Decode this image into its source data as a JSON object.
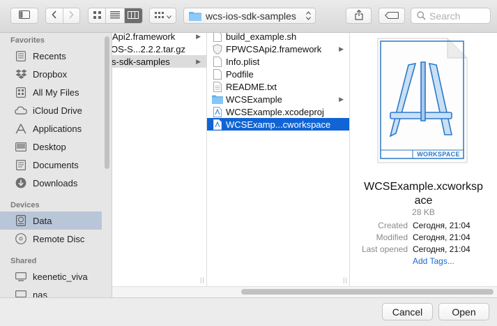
{
  "toolbar": {
    "path_folder": "wcs-ios-sdk-samples",
    "search_placeholder": "Search"
  },
  "sidebar": {
    "favorites_header": "Favorites",
    "favorites": [
      "Recents",
      "Dropbox",
      "All My Files",
      "iCloud Drive",
      "Applications",
      "Desktop",
      "Documents",
      "Downloads"
    ],
    "devices_header": "Devices",
    "devices": [
      "Data",
      "Remote Disc"
    ],
    "shared_header": "Shared",
    "shared": [
      "keenetic_viva",
      "nas"
    ]
  },
  "column1": {
    "items": [
      "Api2.framework",
      "OS-S...2.2.2.tar.gz",
      "s-sdk-samples"
    ]
  },
  "column2": {
    "items": [
      "build_example.sh",
      "FPWCSApi2.framework",
      "Info.plist",
      "Podfile",
      "README.txt",
      "WCSExample",
      "WCSExample.xcodeproj",
      "WCSExamp...cworkspace"
    ]
  },
  "preview": {
    "badge": "WORKSPACE",
    "filename_line1": "WCSExample.xcworksp",
    "filename_line2": "ace",
    "size": "28 KB",
    "created_label": "Created",
    "created_value": "Сегодня, 21:04",
    "modified_label": "Modified",
    "modified_value": "Сегодня, 21:04",
    "opened_label": "Last opened",
    "opened_value": "Сегодня, 21:04",
    "add_tags": "Add Tags..."
  },
  "buttons": {
    "cancel": "Cancel",
    "open": "Open"
  },
  "colors": {
    "selection_blue": "#1064d5",
    "sidebar_selection": "#b9c6d8",
    "link_blue": "#1a6ad8"
  }
}
